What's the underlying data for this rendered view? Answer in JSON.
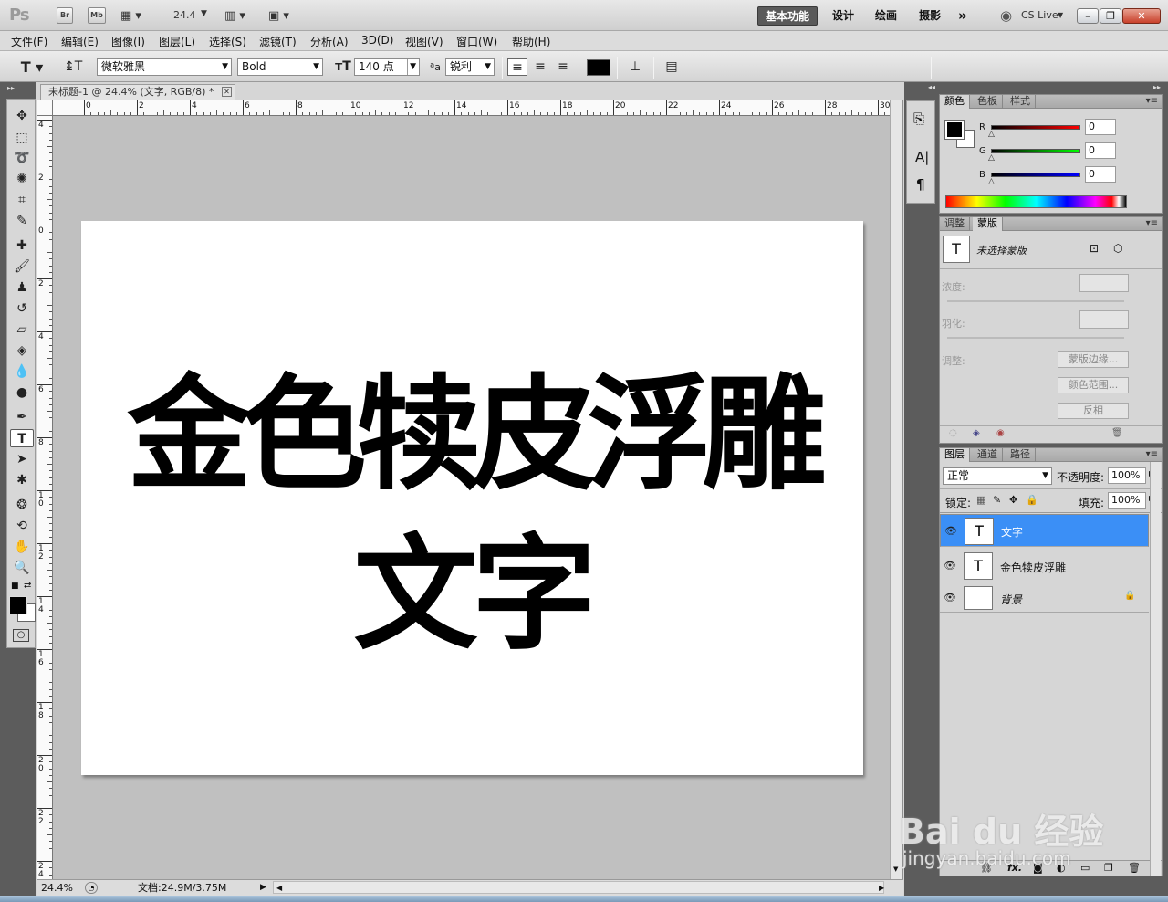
{
  "titlebar": {
    "app_logo": "Ps",
    "bridge": "Br",
    "minibridge": "Mb",
    "zoom": "24.4",
    "workspaces": [
      "基本功能",
      "设计",
      "绘画",
      "摄影"
    ],
    "more": "»",
    "cslive": "CS Live",
    "win_min": "–",
    "win_restore": "❐",
    "win_close": "✕"
  },
  "menu": [
    "文件(F)",
    "编辑(E)",
    "图像(I)",
    "图层(L)",
    "选择(S)",
    "滤镜(T)",
    "分析(A)",
    "3D(D)",
    "视图(V)",
    "窗口(W)",
    "帮助(H)"
  ],
  "options": {
    "font_family": "微软雅黑",
    "font_style": "Bold",
    "font_size": "140 点",
    "antialias_label": "ªa",
    "antialias": "锐利",
    "text_color": "#000000"
  },
  "document": {
    "tab_title": "未标题-1 @ 24.4% (文字, RGB/8) *",
    "line1": "金色犊皮浮雕",
    "line2": "文字",
    "h_ruler": [
      "0",
      "2",
      "4",
      "6",
      "8",
      "10",
      "12",
      "14",
      "16",
      "18",
      "20",
      "22",
      "24",
      "26",
      "28",
      "30"
    ],
    "v_ruler": [
      "4",
      "2",
      "0",
      "2",
      "4",
      "6",
      "8",
      "10",
      "12",
      "14",
      "16",
      "18",
      "20",
      "22",
      "24"
    ]
  },
  "status": {
    "zoom": "24.4%",
    "doc_info": "文档:24.9M/3.75M"
  },
  "color_panel": {
    "tabs": [
      "颜色",
      "色板",
      "样式"
    ],
    "r_label": "R",
    "g_label": "G",
    "b_label": "B",
    "r": "0",
    "g": "0",
    "b": "0",
    "foreground": "#000000",
    "background": "#ffffff"
  },
  "masks_panel": {
    "tabs": [
      "调整",
      "蒙版"
    ],
    "title": "未选择蒙版",
    "density_label": "浓度:",
    "feather_label": "羽化:",
    "refine_label": "调整:",
    "btn_edge": "蒙版边缘...",
    "btn_range": "颜色范围...",
    "btn_invert": "反相"
  },
  "layers_panel": {
    "tabs": [
      "图层",
      "通道",
      "路径"
    ],
    "blend_mode": "正常",
    "opacity_label": "不透明度:",
    "opacity": "100%",
    "lock_label": "锁定:",
    "fill_label": "填充:",
    "fill": "100%",
    "layers": [
      {
        "name": "文字",
        "thumb": "T",
        "selected": true
      },
      {
        "name": "金色犊皮浮雕",
        "thumb": "T",
        "selected": false
      },
      {
        "name": "背景",
        "thumb": "",
        "selected": false
      }
    ],
    "footer_fx": "fx."
  },
  "watermark": {
    "logo": "Bai du 经验",
    "url": "jingyan.baidu.com"
  }
}
